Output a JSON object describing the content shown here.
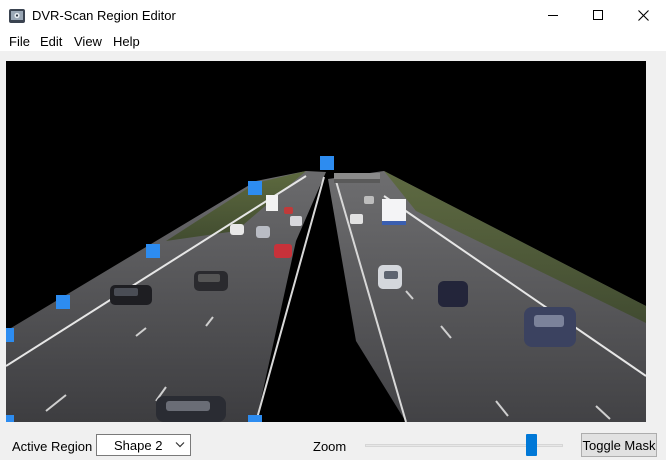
{
  "window": {
    "title": "DVR-Scan Region Editor"
  },
  "menu": {
    "items": [
      "File",
      "Edit",
      "View",
      "Help"
    ]
  },
  "controls": {
    "active_region_label": "Active Region",
    "active_region_value": "Shape 2",
    "zoom_label": "Zoom",
    "zoom_level": 0.86,
    "toggle_mask_label": "Toggle Mask"
  },
  "colors": {
    "handle": "#2d8cf0",
    "accent": "#0078d7"
  },
  "icons": {
    "app": "dvr-scan-app-icon",
    "minimize": "minimize-icon",
    "maximize": "maximize-icon",
    "close": "close-icon",
    "dropdown": "chevron-down-icon"
  }
}
